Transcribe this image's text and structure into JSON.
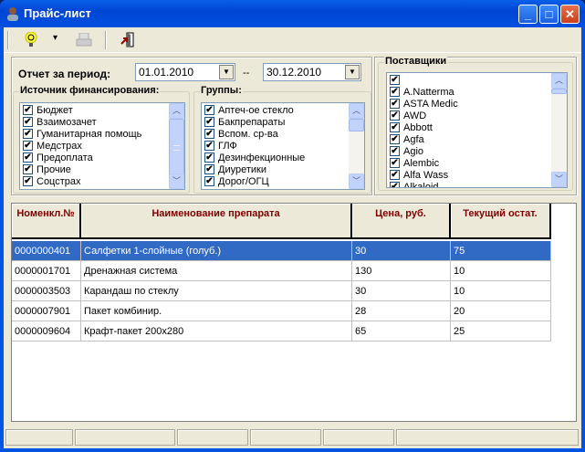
{
  "window": {
    "title": "Прайс-лист",
    "minimize": "_",
    "maximize": "□",
    "close": "✕"
  },
  "toolbar": {
    "dropdown_arrow": "▾"
  },
  "period": {
    "label": "Отчет за период:",
    "from": "01.01.2010",
    "separator": "--",
    "to": "30.12.2010"
  },
  "sources": {
    "label": "Источник финансирования:",
    "items": [
      "Бюджет",
      "Взаимозачет",
      "Гуманитарная помощь",
      "Медстрах",
      "Предоплата",
      "Прочие",
      "Соцстрах"
    ]
  },
  "groups": {
    "label": "Группы:",
    "items": [
      "Аптеч-ое стекло",
      "Бакпрепараты",
      "Вспом. ср-ва",
      "ГЛФ",
      "Дезинфекционные",
      "Диуретики",
      "Дорог/ОГЦ"
    ]
  },
  "suppliers": {
    "label": "Поставщики",
    "items": [
      "",
      "A.Natterma",
      "ASTA Medic",
      "AWD",
      "Abbott",
      "Agfa",
      "Agio",
      "Alembic",
      "Alfa Wass",
      "Alkaloid"
    ]
  },
  "table": {
    "columns": [
      "Номенкл.№",
      "Наименование препарата",
      "Цена, руб.",
      "Текущий остат."
    ],
    "rows": [
      [
        "0000000401",
        "Салфетки 1-слойные (голуб.)",
        "30",
        "75"
      ],
      [
        "0000001701",
        "Дренажная система",
        "130",
        "10"
      ],
      [
        "0000003503",
        "Карандаш по стеклу",
        "30",
        "10"
      ],
      [
        "0000007901",
        "Пакет комбинир.",
        "28",
        "20"
      ],
      [
        "0000009604",
        "Крафт-пакет 200x280",
        "65",
        "25"
      ]
    ],
    "selected_row": 0
  },
  "colors": {
    "selection": "#316ac5",
    "header_text": "#800000"
  }
}
